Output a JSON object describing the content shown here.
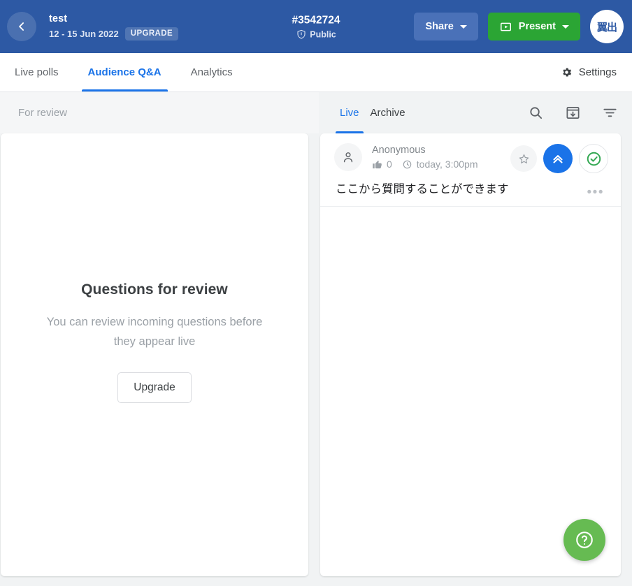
{
  "header": {
    "back_icon": "chevron-left-icon",
    "event_title": "test",
    "event_date": "12 - 15 Jun 2022",
    "upgrade_chip": "UPGRADE",
    "event_code": "#3542724",
    "visibility": "Public",
    "visibility_icon": "shield-alert-icon",
    "share_label": "Share",
    "present_label": "Present",
    "present_icon": "play-box-icon",
    "avatar_initials": "翼出",
    "colors": {
      "header_bg": "#2d59a4",
      "share_bg": "#4a71b8",
      "present_bg": "#2ba534",
      "accent_blue": "#1a73e8"
    }
  },
  "tabs": [
    {
      "label": "Live polls",
      "active": false
    },
    {
      "label": "Audience Q&A",
      "active": true
    },
    {
      "label": "Analytics",
      "active": false
    }
  ],
  "settings": {
    "label": "Settings",
    "icon": "gear-icon"
  },
  "review_panel": {
    "column_label": "For review",
    "empty_title": "Questions for review",
    "empty_desc": "You can review incoming questions before they appear live",
    "upgrade_button": "Upgrade"
  },
  "questions_panel": {
    "segments": [
      {
        "label": "Live",
        "active": true
      },
      {
        "label": "Archive",
        "active": false
      }
    ],
    "icons": [
      {
        "name": "search-icon"
      },
      {
        "name": "archive-download-icon"
      },
      {
        "name": "filter-icon"
      }
    ],
    "items": [
      {
        "author": "Anonymous",
        "author_icon": "person-icon",
        "like_icon": "thumb-up-icon",
        "likes": "0",
        "time_icon": "clock-icon",
        "time": "today, 3:00pm",
        "text": "ここから質問することができます",
        "star_icon": "star-outline-icon",
        "upvote_icon": "double-chevron-up-icon",
        "approve_icon": "check-circle-icon",
        "more_icon": "ellipsis-icon",
        "more_label": "•••"
      }
    ]
  },
  "help_fab": {
    "icon": "help-circle-icon",
    "color": "#66bb52"
  }
}
